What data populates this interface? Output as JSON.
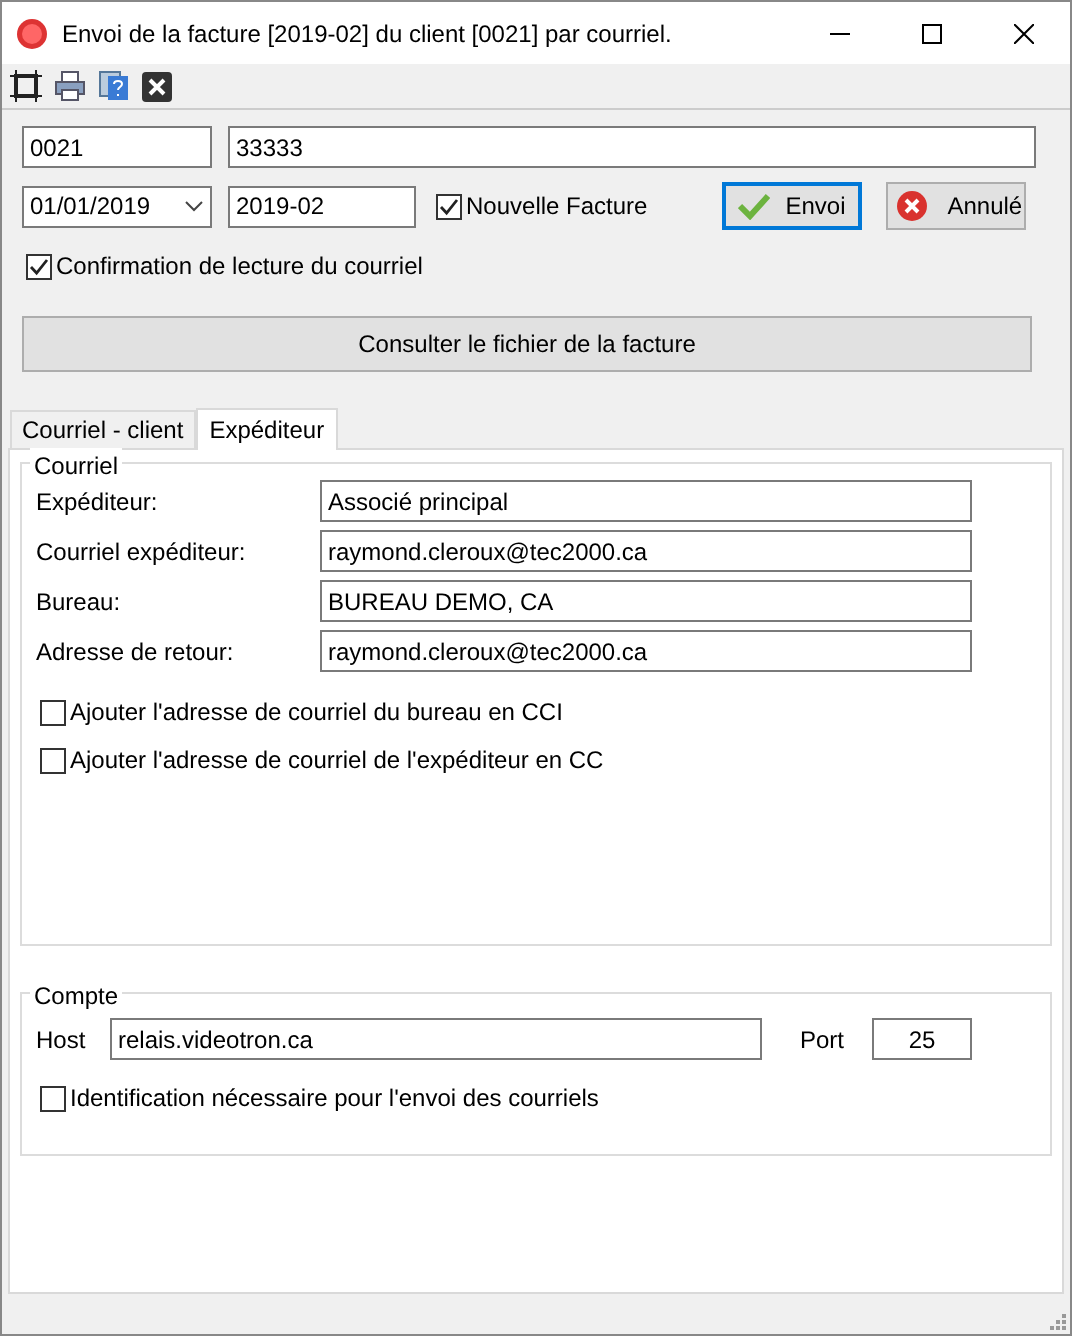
{
  "window": {
    "title": "Envoi de la facture [2019-02] du client [0021] par courriel."
  },
  "header": {
    "client_code": "0021",
    "client_name": "33333",
    "date": "01/01/2019",
    "invoice": "2019-02",
    "new_invoice": {
      "label": "Nouvelle Facture",
      "checked": true
    },
    "read_receipt": {
      "label": "Confirmation de lecture du courriel",
      "checked": true
    },
    "send_button": "Envoi",
    "cancel_button": "Annulé",
    "view_button": "Consulter le fichier de la facture"
  },
  "tabs": [
    {
      "label": "Courriel - client",
      "selected": false
    },
    {
      "label": "Expéditeur",
      "selected": true
    }
  ],
  "courriel": {
    "title": "Courriel",
    "fields": [
      {
        "label": "Expéditeur:",
        "value": "Associé principal"
      },
      {
        "label": "Courriel expéditeur:",
        "value": "raymond.cleroux@tec2000.ca"
      },
      {
        "label": "Bureau:",
        "value": "BUREAU DEMO, CA"
      },
      {
        "label": "Adresse de retour:",
        "value": "raymond.cleroux@tec2000.ca"
      }
    ],
    "options": [
      {
        "label": "Ajouter l'adresse de courriel du bureau en CCI",
        "checked": false
      },
      {
        "label": "Ajouter l'adresse de courriel de l'expéditeur en CC",
        "checked": false
      }
    ]
  },
  "compte": {
    "title": "Compte",
    "host_label": "Host",
    "host": "relais.videotron.ca",
    "port_label": "Port",
    "port": "25",
    "auth": {
      "label": "Identification nécessaire pour l'envoi des courriels",
      "checked": false
    }
  }
}
